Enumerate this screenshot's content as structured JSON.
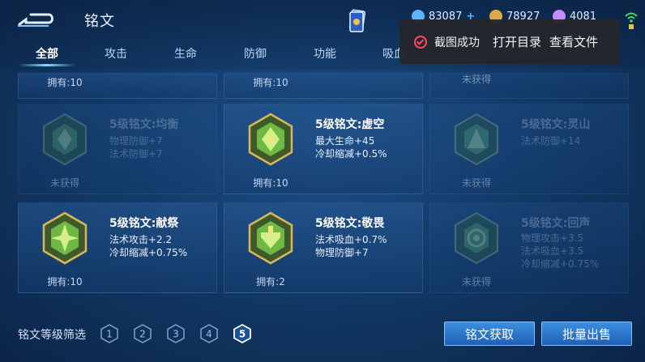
{
  "header": {
    "title": "铭文",
    "resources": [
      {
        "value": "83087",
        "color": "#5fb3ff",
        "has_plus": true
      },
      {
        "value": "78927",
        "color": "#e0a74a",
        "has_plus": false
      },
      {
        "value": "4081",
        "color": "#c58bff",
        "has_plus": false
      }
    ],
    "plus_symbol": "+"
  },
  "tabs": [
    {
      "label": "全部",
      "active": true
    },
    {
      "label": "攻击",
      "active": false
    },
    {
      "label": "生命",
      "active": false
    },
    {
      "label": "防御",
      "active": false
    },
    {
      "label": "功能",
      "active": false
    },
    {
      "label": "吸血",
      "active": false
    }
  ],
  "toast": {
    "message": "截图成功",
    "action_open": "打开目录",
    "action_view": "查看文件"
  },
  "top_partial_row": [
    {
      "owned": "拥有:10"
    },
    {
      "owned": "拥有:10"
    },
    {
      "owned": "未获得"
    }
  ],
  "inscriptions": [
    {
      "name": "5级铭文:均衡",
      "attrs": [
        "物理防御+7",
        "法术防御+7"
      ],
      "owned": "未获得",
      "acquired": false,
      "color": "#4f9a6c"
    },
    {
      "name": "5级铭文:虚空",
      "attrs": [
        "最大生命+45",
        "冷却缩减+0.5%"
      ],
      "owned": "拥有:10",
      "acquired": true,
      "color": "#6fb844"
    },
    {
      "name": "5级铭文:灵山",
      "attrs": [
        "法术防御+14"
      ],
      "owned": "未获得",
      "acquired": false,
      "color": "#4f9a6c"
    },
    {
      "name": "5级铭文:献祭",
      "attrs": [
        "法术攻击+2.2",
        "冷却缩减+0.75%"
      ],
      "owned": "拥有:10",
      "acquired": true,
      "color": "#6fb844"
    },
    {
      "name": "5级铭文:敬畏",
      "attrs": [
        "法术吸血+0.7%",
        "物理防御+7"
      ],
      "owned": "拥有:2",
      "acquired": true,
      "color": "#6fb844"
    },
    {
      "name": "5级铭文:回声",
      "attrs": [
        "物理攻击+3.5",
        "法术吸血+3.5",
        "冷却缩减+0.75%"
      ],
      "owned": "未获得",
      "acquired": false,
      "color": "#4f9a6c"
    }
  ],
  "footer": {
    "filter_label": "铭文等级筛选",
    "levels": [
      {
        "label": "1",
        "selected": false
      },
      {
        "label": "2",
        "selected": false
      },
      {
        "label": "3",
        "selected": false
      },
      {
        "label": "4",
        "selected": false
      },
      {
        "label": "5",
        "selected": true
      }
    ],
    "acquire_button": "铭文获取",
    "sell_button": "批量出售"
  }
}
